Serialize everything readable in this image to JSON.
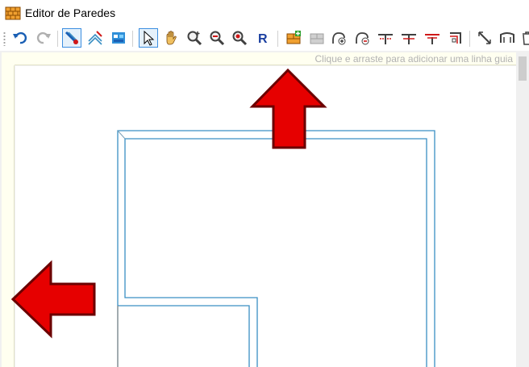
{
  "window": {
    "title": "Editor de Paredes",
    "icon": "brick-wall-icon"
  },
  "toolbar": {
    "buttons": [
      {
        "name": "undo-button",
        "icon": "undo-icon",
        "active": false,
        "enabled": true
      },
      {
        "name": "redo-button",
        "icon": "redo-icon",
        "active": false,
        "enabled": false
      },
      {
        "name": "draw-wall-button",
        "icon": "pencil-wall-icon",
        "active": true,
        "enabled": true
      },
      {
        "name": "edit-wall-button",
        "icon": "wall-edit-icon",
        "active": false,
        "enabled": true
      },
      {
        "name": "wall-layers-button",
        "icon": "wall-layers-icon",
        "active": false,
        "enabled": true
      },
      {
        "name": "select-button",
        "icon": "cursor-icon",
        "active": true,
        "enabled": true
      },
      {
        "name": "pan-button",
        "icon": "hand-icon",
        "active": false,
        "enabled": true
      },
      {
        "name": "zoom-in-button",
        "icon": "zoom-in-icon",
        "active": false,
        "enabled": true
      },
      {
        "name": "zoom-out-button",
        "icon": "zoom-out-icon",
        "active": false,
        "enabled": true
      },
      {
        "name": "zoom-fit-button",
        "icon": "zoom-fit-icon",
        "active": false,
        "enabled": true
      },
      {
        "name": "refresh-button",
        "icon": "r-icon",
        "active": false,
        "enabled": true
      },
      {
        "name": "add-wall-button",
        "icon": "brick-add-icon",
        "active": false,
        "enabled": true
      },
      {
        "name": "remove-wall-button",
        "icon": "brick-remove-icon",
        "active": false,
        "enabled": false
      },
      {
        "name": "add-node-button",
        "icon": "node-add-icon",
        "active": false,
        "enabled": true
      },
      {
        "name": "remove-node-button",
        "icon": "node-remove-icon",
        "active": false,
        "enabled": true
      },
      {
        "name": "split-wall-button",
        "icon": "split-wall-icon",
        "active": false,
        "enabled": true
      },
      {
        "name": "join-wall-button",
        "icon": "join-wall-icon",
        "active": false,
        "enabled": true
      },
      {
        "name": "t-junction-button",
        "icon": "t-junction-icon",
        "active": false,
        "enabled": true
      },
      {
        "name": "corner-button",
        "icon": "corner-icon",
        "active": false,
        "enabled": true
      },
      {
        "name": "measure-button",
        "icon": "measure-icon",
        "active": false,
        "enabled": true
      },
      {
        "name": "arc-button",
        "icon": "arc-icon",
        "active": false,
        "enabled": true
      },
      {
        "name": "delete-button",
        "icon": "trash-icon",
        "active": false,
        "enabled": true
      }
    ]
  },
  "canvas": {
    "guide_hint": "Clique e arraste para adicionar uma linha guia",
    "wall_color": "#3a8fc4",
    "ruler_color": "#fffff0"
  },
  "annotations": {
    "arrow_color": "#e60000",
    "arrow_outline": "#6b0000",
    "arrows": [
      {
        "name": "arrow-up-annotation",
        "direction": "up"
      },
      {
        "name": "arrow-left-annotation",
        "direction": "left"
      }
    ]
  }
}
